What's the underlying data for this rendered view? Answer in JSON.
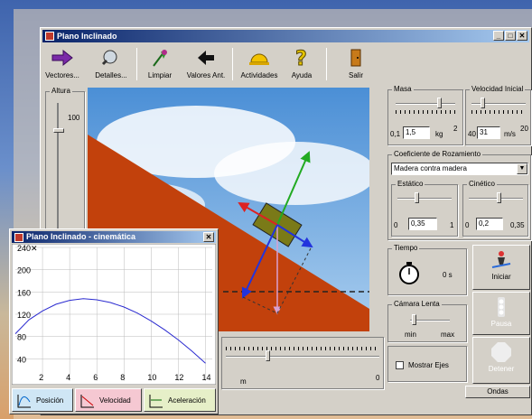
{
  "window": {
    "title": "Plano Inclinado"
  },
  "toolbar": [
    {
      "label": "Vectores...",
      "icon": "arrow-right-icon"
    },
    {
      "label": "Detalles...",
      "icon": "magnifier-icon"
    },
    {
      "label": "Limpiar",
      "icon": "broom-icon"
    },
    {
      "label": "Valores Ant.",
      "icon": "arrow-left-icon"
    },
    {
      "label": "Actividades",
      "icon": "hardhat-icon"
    },
    {
      "label": "Ayuda",
      "icon": "question-icon"
    },
    {
      "label": "Salir",
      "icon": "door-exit-icon"
    }
  ],
  "altura": {
    "label": "Altura",
    "value": "100"
  },
  "masa": {
    "label": "Masa",
    "min": "0,1",
    "value": "1,5",
    "unit": "kg",
    "max": "2",
    "level": 0.73
  },
  "velocidad": {
    "label": "Velocidad Inicial",
    "min": "40",
    "value": "31",
    "unit": "m/s",
    "max": "20",
    "level": 0.2
  },
  "rozamiento": {
    "label": "Coeficiente de Rozamiento",
    "selected": "Madera contra madera",
    "estatico": {
      "label": "Estático",
      "min": "0",
      "value": "0,35",
      "max": "1",
      "level": 0.35
    },
    "cinetico": {
      "label": "Cinético",
      "min": "0",
      "value": "0,2",
      "max": "0,35",
      "level": 0.55
    }
  },
  "tiempo": {
    "label": "Tiempo",
    "value": "0 s"
  },
  "camara": {
    "label": "Cámara Lenta",
    "min": "min",
    "max": "max"
  },
  "controles": {
    "iniciar": "Iniciar",
    "pausa": "Pausa",
    "detener": "Detener",
    "ondas": "Ondas"
  },
  "mostrar_ejes": "Mostrar Ejes",
  "bottom": {
    "unit": "m",
    "value": "0"
  },
  "cinematica": {
    "title": "Plano Inclinado - cinemática",
    "tabs": [
      "Posición",
      "Velocidad",
      "Aceleración"
    ],
    "chart_data": {
      "type": "line",
      "x": [
        0,
        1,
        2,
        3,
        4,
        5,
        6,
        7,
        8,
        9,
        10,
        11,
        12,
        13,
        14
      ],
      "series": [
        {
          "values": [
            85,
            110,
            126,
            138,
            145,
            148,
            146,
            141,
            133,
            122,
            108,
            92,
            74,
            54,
            32
          ]
        }
      ],
      "xlim": [
        0,
        14.5
      ],
      "ylim": [
        0,
        240
      ],
      "xticks": [
        "2",
        "4",
        "6",
        "8",
        "10",
        "12",
        "14"
      ],
      "yticks": [
        "40",
        "80",
        "120",
        "160",
        "200",
        "240"
      ],
      "ymax_label": "240"
    }
  }
}
